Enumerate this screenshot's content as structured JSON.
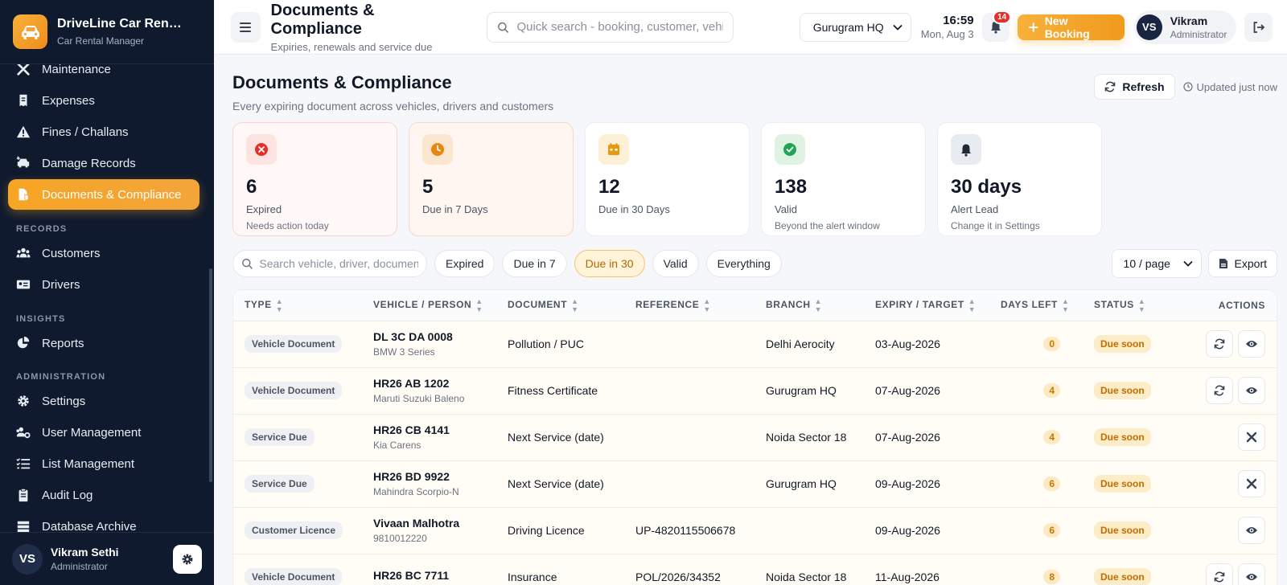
{
  "brand": {
    "title": "DriveLine Car Rent…",
    "subtitle": "Car Rental Manager"
  },
  "sidebar": {
    "items": [
      {
        "label": "Maintenance",
        "icon": "wrench-icon"
      },
      {
        "label": "Expenses",
        "icon": "receipt-icon"
      },
      {
        "label": "Fines / Challans",
        "icon": "warning-icon"
      },
      {
        "label": "Damage Records",
        "icon": "car-crash-icon"
      },
      {
        "label": "Documents & Compliance",
        "icon": "document-shield-icon",
        "active": true
      }
    ],
    "sections": {
      "records": "RECORDS",
      "insights": "INSIGHTS",
      "administration": "ADMINISTRATION"
    },
    "records_items": [
      {
        "label": "Customers",
        "icon": "users-icon"
      },
      {
        "label": "Drivers",
        "icon": "id-card-icon"
      }
    ],
    "insights_items": [
      {
        "label": "Reports",
        "icon": "pie-chart-icon"
      }
    ],
    "admin_items": [
      {
        "label": "Settings",
        "icon": "gear-icon"
      },
      {
        "label": "User Management",
        "icon": "user-gear-icon"
      },
      {
        "label": "List Management",
        "icon": "list-check-icon"
      },
      {
        "label": "Audit Log",
        "icon": "clipboard-icon"
      },
      {
        "label": "Database Archive",
        "icon": "database-icon"
      }
    ],
    "user": {
      "initials": "VS",
      "name": "Vikram Sethi",
      "role": "Administrator"
    }
  },
  "topbar": {
    "title": "Documents & Compliance",
    "subtitle": "Expiries, renewals and service due",
    "search_placeholder": "Quick search - booking, customer, vehicle",
    "branch": "Gurugram HQ",
    "time": "16:59",
    "date": "Mon, Aug 3",
    "notifications": "14",
    "new_booking": "New Booking",
    "user": {
      "initials": "VS",
      "name": "Vikram",
      "role": "Administrator"
    }
  },
  "page": {
    "title": "Documents & Compliance",
    "description": "Every expiring document across vehicles, drivers and customers",
    "refresh": "Refresh",
    "updated": "Updated just now"
  },
  "stats": [
    {
      "value": "6",
      "label": "Expired",
      "sub": "Needs action today"
    },
    {
      "value": "5",
      "label": "Due in 7 Days",
      "sub": ""
    },
    {
      "value": "12",
      "label": "Due in 30 Days",
      "sub": ""
    },
    {
      "value": "138",
      "label": "Valid",
      "sub": "Beyond the alert window"
    },
    {
      "value": "30 days",
      "label": "Alert Lead",
      "sub": "Change it in Settings"
    }
  ],
  "colors": {
    "accent": "#f6a524",
    "expired": "#e2312b",
    "warning": "#f08c1a",
    "valid": "#22a552",
    "sidebar": "#0f1a2e"
  },
  "filters": {
    "search_placeholder": "Search vehicle, driver, document",
    "chips": [
      "Expired",
      "Due in 7",
      "Due in 30",
      "Valid",
      "Everything"
    ],
    "active": "Due in 30",
    "per_page": "10 / page",
    "export": "Export"
  },
  "table": {
    "headers": [
      "TYPE",
      "VEHICLE / PERSON",
      "DOCUMENT",
      "REFERENCE",
      "BRANCH",
      "EXPIRY / TARGET",
      "DAYS LEFT",
      "STATUS",
      "ACTIONS"
    ],
    "rows": [
      {
        "type": "Vehicle Document",
        "main": "DL 3C DA 0008",
        "sub": "BMW 3 Series",
        "document": "Pollution / PUC",
        "reference": "",
        "branch": "Delhi Aerocity",
        "expiry": "03-Aug-2026",
        "days": "0",
        "status": "Due soon",
        "actions": [
          "renew",
          "view"
        ]
      },
      {
        "type": "Vehicle Document",
        "main": "HR26 AB 1202",
        "sub": "Maruti Suzuki Baleno",
        "document": "Fitness Certificate",
        "reference": "",
        "branch": "Gurugram HQ",
        "expiry": "07-Aug-2026",
        "days": "4",
        "status": "Due soon",
        "actions": [
          "renew",
          "view"
        ]
      },
      {
        "type": "Service Due",
        "main": "HR26 CB 4141",
        "sub": "Kia Carens",
        "document": "Next Service (date)",
        "reference": "",
        "branch": "Noida Sector 18",
        "expiry": "07-Aug-2026",
        "days": "4",
        "status": "Due soon",
        "actions": [
          "service"
        ]
      },
      {
        "type": "Service Due",
        "main": "HR26 BD 9922",
        "sub": "Mahindra Scorpio-N",
        "document": "Next Service (date)",
        "reference": "",
        "branch": "Gurugram HQ",
        "expiry": "09-Aug-2026",
        "days": "6",
        "status": "Due soon",
        "actions": [
          "service"
        ]
      },
      {
        "type": "Customer Licence",
        "main": "Vivaan Malhotra",
        "sub": "9810012220",
        "document": "Driving Licence",
        "reference": "UP-4820115506678",
        "branch": "",
        "expiry": "09-Aug-2026",
        "days": "6",
        "status": "Due soon",
        "actions": [
          "view"
        ]
      },
      {
        "type": "Vehicle Document",
        "main": "HR26 BC 7711",
        "sub": "",
        "document": "Insurance",
        "reference": "POL/2026/34352",
        "branch": "Noida Sector 18",
        "expiry": "11-Aug-2026",
        "days": "8",
        "status": "Due soon",
        "actions": [
          "renew",
          "view"
        ]
      }
    ]
  }
}
